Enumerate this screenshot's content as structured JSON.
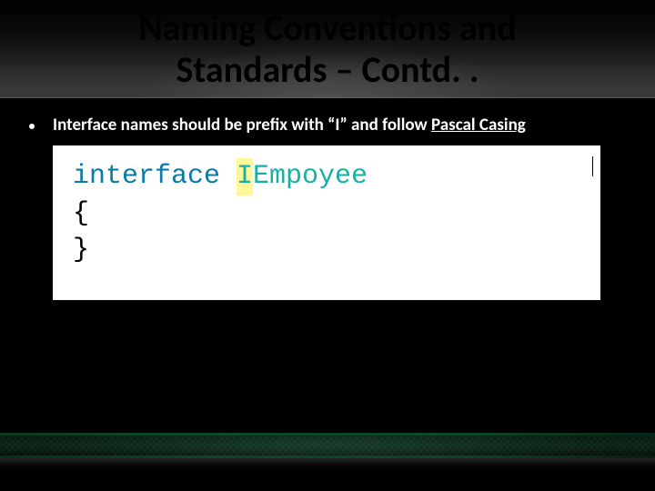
{
  "title_line1": "Naming Conventions and",
  "title_line2": "Standards – Contd. .",
  "bullet": {
    "text_prefix": "Interface names should be prefix with “I” and follow ",
    "link_text": "Pascal Casing"
  },
  "code": {
    "keyword": "interface",
    "highlighted_prefix": "I",
    "typename_rest": "Empoyee",
    "open_brace": "{",
    "close_brace": "}"
  }
}
